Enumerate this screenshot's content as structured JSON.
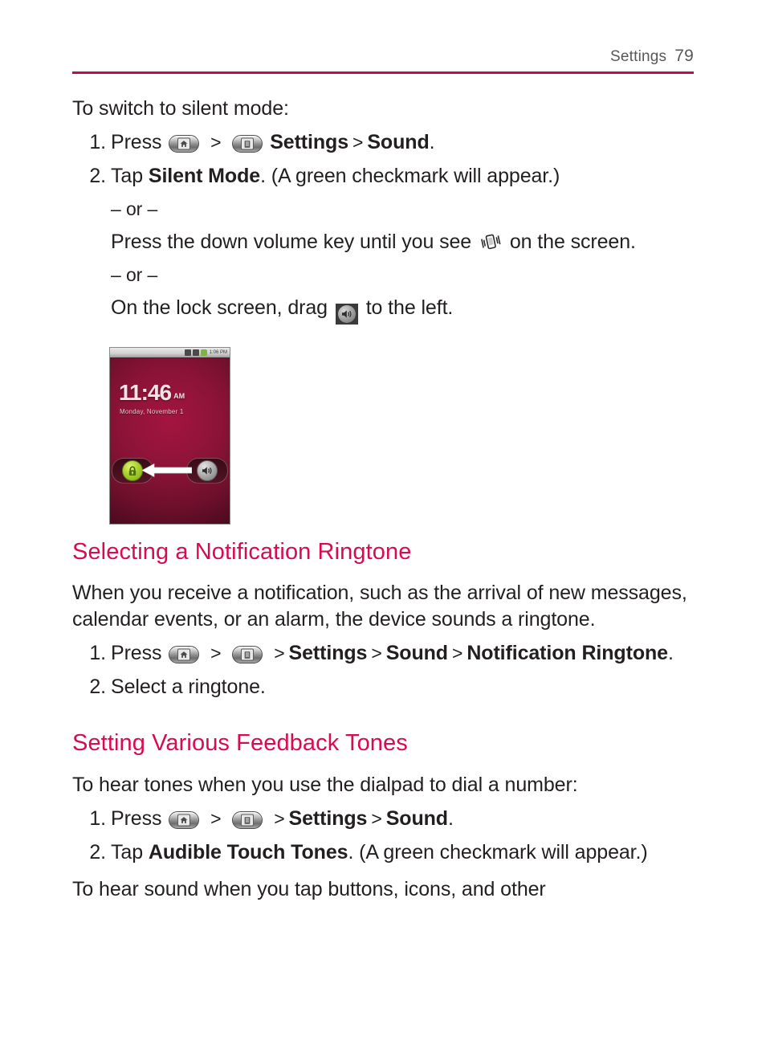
{
  "header": {
    "title": "Settings",
    "page_number": "79",
    "rule_color": "#b5104f"
  },
  "theme": {
    "heading_color": "#d80b52",
    "body_color": "#231f20"
  },
  "sections": {
    "silent_mode": {
      "intro": "To switch to silent mode:",
      "step1": {
        "num": "1.",
        "press": "Press",
        "gt1": ">",
        "gt2": ">",
        "settings": "Settings",
        "sound": "Sound",
        "period": "."
      },
      "step2": {
        "num": "2.",
        "tap": "Tap",
        "silent_mode": "Silent Mode",
        "tail": ". (A green checkmark will appear.)"
      },
      "or1": "– or –",
      "alt1_before": "Press the down volume key until you see",
      "alt1_after": "on the screen.",
      "or2": "– or –",
      "alt2_before": "On the lock screen, drag",
      "alt2_after": "to the left."
    },
    "phone_screenshot": {
      "status_time": "1:06 PM",
      "clock_time": "11:46",
      "clock_ampm": "AM",
      "date": "Monday, November 1",
      "lock_icon_name": "lock-icon",
      "sound_icon_name": "sound-icon",
      "arrow_direction": "left"
    },
    "notification_ringtone": {
      "heading": "Selecting a Notification Ringtone",
      "paragraph": "When you receive a notification, such as the arrival of new messages, calendar events, or an alarm, the device sounds a ringtone.",
      "step1": {
        "num": "1.",
        "press": "Press",
        "gt1": ">",
        "gt2": ">",
        "gt3": ">",
        "gt4": ">",
        "gt5": ">",
        "settings": "Settings",
        "sound": "Sound",
        "notification_ringtone": "Notification Ringtone",
        "period": "."
      },
      "step2": {
        "num": "2.",
        "text": "Select a ringtone."
      }
    },
    "feedback_tones": {
      "heading": "Setting Various Feedback Tones",
      "intro": "To hear tones when you use the dialpad to dial a number:",
      "step1": {
        "num": "1.",
        "press": "Press",
        "gt1": ">",
        "gt2": ">",
        "gt3": ">",
        "settings": "Settings",
        "sound": "Sound",
        "period": "."
      },
      "step2": {
        "num": "2.",
        "tap": "Tap",
        "audible_touch_tones": "Audible Touch Tones",
        "tail": ". (A green checkmark will appear.)"
      },
      "closing": "To hear sound when you tap buttons, icons, and other"
    }
  }
}
